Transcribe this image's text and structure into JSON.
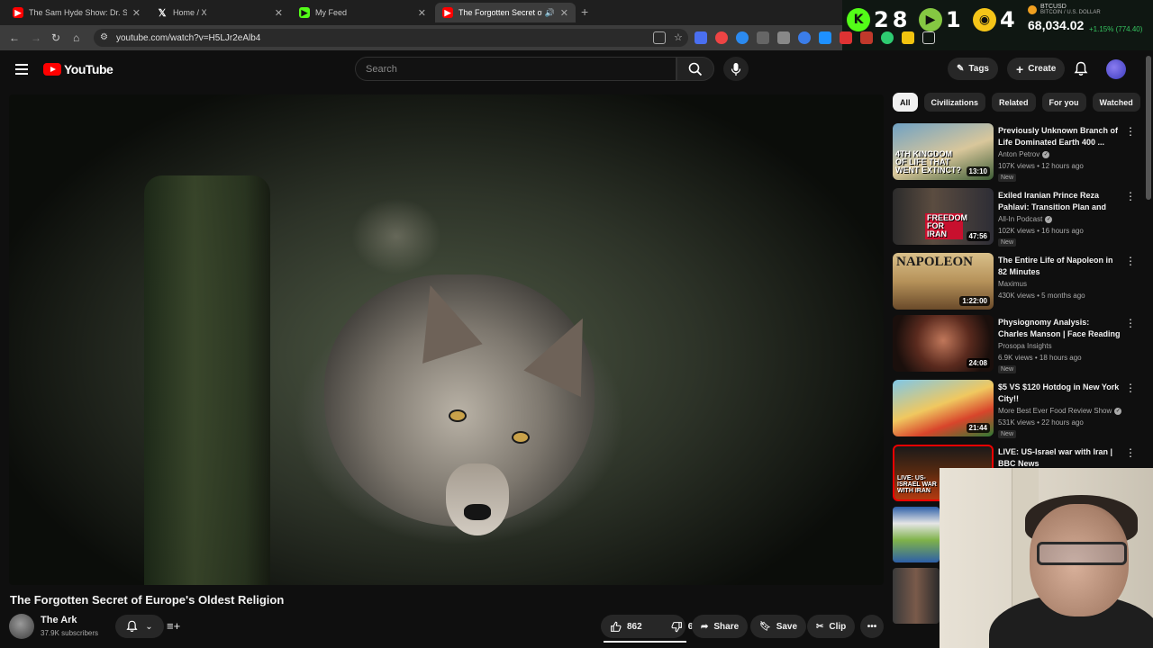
{
  "browser": {
    "tabs": [
      {
        "title": "The Sam Hyde Show: Dr. Seuss",
        "icon": "youtube-icon",
        "active": false
      },
      {
        "title": "Home / X",
        "icon": "x-icon",
        "active": false
      },
      {
        "title": "My Feed",
        "icon": "play-icon",
        "active": false
      },
      {
        "title": "The Forgotten Secret of Eu",
        "icon": "youtube-icon",
        "active": true
      }
    ],
    "url": "youtube.com/watch?v=H5LJr2eAlb4",
    "overlay_counts": [
      "2",
      "8",
      "1",
      "4"
    ],
    "ticker": {
      "symbol": "BTCUSD",
      "pair": "BITCOIN / U.S. DOLLAR",
      "price": "68,034.02",
      "change": "+1.15% (774.40)"
    }
  },
  "youtube": {
    "logo_text": "YouTube",
    "search_placeholder": "Search",
    "tags_label": "Tags",
    "create_label": "Create",
    "video": {
      "title": "The Forgotten Secret of Europe's Oldest Religion",
      "channel": "The Ark",
      "subscribers": "37.9K subscribers",
      "likes": "862",
      "dislikes": "6",
      "share_label": "Share",
      "save_label": "Save",
      "clip_label": "Clip"
    },
    "chips": [
      "All",
      "Civilizations",
      "Related",
      "For you",
      "Watched"
    ],
    "recommendations": [
      {
        "title": "Previously Unknown Branch of Life Dominated Earth 400 ...",
        "channel": "Anton Petrov",
        "verified": true,
        "meta": "107K views • 12 hours ago",
        "badge": "New",
        "duration": "13:10",
        "thumb_text": "4TH KINGDOM OF LIFE THAT WENT EXTINCT?"
      },
      {
        "title": "Exiled Iranian Prince Reza Pahlavi: Transition Plan and th...",
        "channel": "All-In Podcast",
        "verified": true,
        "meta": "102K views • 16 hours ago",
        "badge": "New",
        "duration": "47:56",
        "thumb_text": "FREEDOM FOR IRAN"
      },
      {
        "title": "The Entire Life of Napoleon in 82 Minutes",
        "channel": "Maximus",
        "verified": false,
        "meta": "430K views • 5 months ago",
        "badge": "",
        "duration": "1:22:00",
        "thumb_text": "NAPOLEON"
      },
      {
        "title": "Physiognomy Analysis: Charles Manson | Face Reading & ...",
        "channel": "Prosopa Insights",
        "verified": false,
        "meta": "6.9K views • 18 hours ago",
        "badge": "New",
        "duration": "24:08",
        "thumb_text": ""
      },
      {
        "title": "$5 VS $120 Hotdog in New York City!!",
        "channel": "More Best Ever Food Review Show",
        "verified": true,
        "meta": "531K views • 22 hours ago",
        "badge": "New",
        "duration": "21:44",
        "thumb_text": ""
      },
      {
        "title": "LIVE: US-Israel war with Iran | BBC News",
        "channel": "",
        "verified": false,
        "meta": "",
        "badge": "",
        "duration": "",
        "thumb_text": "LIVE: US-ISRAEL WAR WITH IRAN"
      }
    ]
  },
  "colors": {
    "youtube_red": "#ff0000",
    "background": "#0f0f0f",
    "chip": "#272727",
    "ticker_up": "#35c35f"
  }
}
